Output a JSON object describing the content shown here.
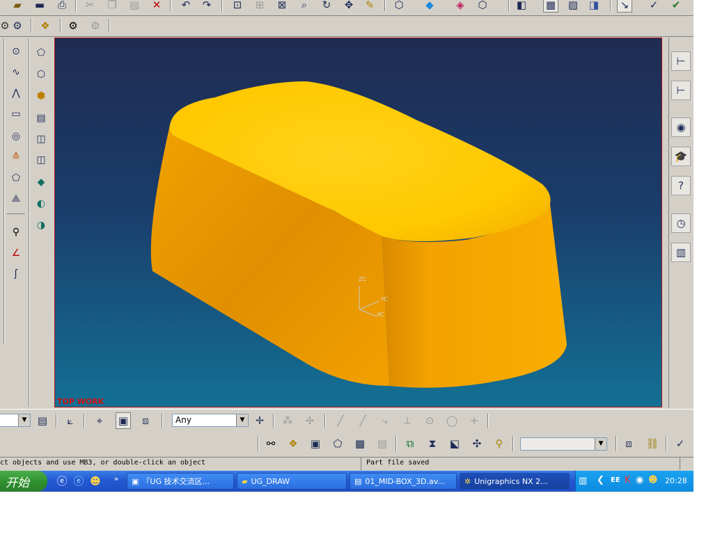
{
  "top_toolbar": {
    "icons": [
      "open-folder-icon",
      "save-icon",
      "print-icon",
      "cut-icon",
      "copy-icon",
      "paste-icon",
      "delete-icon",
      "undo-icon",
      "redo-icon",
      "fit-icon",
      "zoom-window-icon",
      "zoom-icon",
      "magnify-icon",
      "rotate-icon",
      "pan-icon",
      "edit-icon",
      "shaded-cube-icon",
      "colored-cube-icon",
      "solid-cube-icon",
      "wire-cube-icon",
      "layer-icon",
      "assembly-navigator-icon",
      "part-navigator-icon",
      "selection-icon",
      "snap-icon",
      "check-icon"
    ]
  },
  "second_toolbar": {
    "icons": [
      "feature-icon",
      "options-icon",
      "group-icon",
      "gear-icon",
      "gear-disabled-icon"
    ]
  },
  "left_palette": {
    "col1": [
      "point-icon",
      "spline-icon",
      "polyline-icon",
      "rectangle-icon",
      "offset-icon",
      "project-curve-icon",
      "section-icon",
      "intersect-icon",
      "measure-icon",
      "angle-icon",
      "trim-icon"
    ],
    "col2": [
      "wire-box-icon",
      "cube-icon",
      "shaded-box-icon",
      "layer-stack-icon",
      "hollow-icon",
      "split-icon",
      "green-solid-icon",
      "subtract-icon",
      "intersect-solid-icon"
    ]
  },
  "viewport": {
    "work_label": "TOP WORK",
    "axes": {
      "z": "ZC",
      "y": "YC",
      "x": "XC"
    },
    "background_top": "#1f2c52",
    "background_bottom": "#137094",
    "part_color": "#f2a800"
  },
  "right_panel": {
    "icons": [
      "assembly-tree-icon",
      "part-tree-icon",
      "web-browser-icon",
      "training-icon",
      "help-icon",
      "history-icon",
      "palette-icon"
    ]
  },
  "bottom_toolbar1": {
    "filter_value": "Any",
    "icons_left": [
      "scroll-combo-icon",
      "list-icon",
      "csys-icon",
      "target-icon",
      "point-select-icon",
      "cube-select-icon",
      "crosshair-icon",
      "snap-point-disabled-icon",
      "grid-point-disabled-icon",
      "line-end-icon",
      "mid-point-icon",
      "curve-point-icon",
      "arc-center-icon",
      "quadrant-icon",
      "circle-icon",
      "plus-icon"
    ]
  },
  "bottom_toolbar2": {
    "icons": [
      "binoculars-icon",
      "assembly-icon",
      "component-icon",
      "replace-icon",
      "save-image-icon",
      "reopen-icon",
      "add-component-icon",
      "mate-icon",
      "reposition-icon",
      "explode-icon",
      "wave-icon",
      "combo-dropdown",
      "block-icon",
      "link-icon",
      "check-clearance-icon"
    ]
  },
  "status": {
    "left": "ct objects and use MB3, or double-click an object",
    "right": "Part file saved"
  },
  "taskbar": {
    "start_label": "开始",
    "tasks": [
      "『UG 技术交流区...",
      "UG_DRAW",
      "01_MID-BOX_3D.av...",
      "Unigraphics NX 2..."
    ],
    "clock": "20:28",
    "tray_text": "EE"
  }
}
